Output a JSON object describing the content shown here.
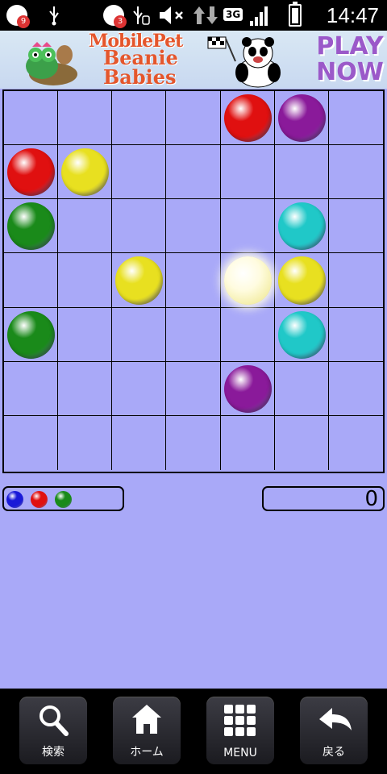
{
  "status_bar": {
    "time": "14:47",
    "network": "3G",
    "notification_badges": [
      "9",
      "3"
    ],
    "icons": [
      "notification-icon",
      "usb-icon",
      "notification-icon",
      "usb-debug-icon",
      "mute-icon",
      "data-transfer-icon",
      "network-3g-icon",
      "signal-icon",
      "battery-icon"
    ]
  },
  "ad": {
    "title_line1": "MobilePet",
    "title_line2": "Beanie",
    "title_line3": "Babies",
    "cta_line1": "PLAY",
    "cta_line2": "NOW"
  },
  "board": {
    "rows": 7,
    "cols": 7,
    "balls": [
      {
        "row": 0,
        "col": 4,
        "color": "red"
      },
      {
        "row": 0,
        "col": 5,
        "color": "purple"
      },
      {
        "row": 1,
        "col": 0,
        "color": "red"
      },
      {
        "row": 1,
        "col": 1,
        "color": "yellow"
      },
      {
        "row": 2,
        "col": 0,
        "color": "green"
      },
      {
        "row": 2,
        "col": 5,
        "color": "cyan"
      },
      {
        "row": 3,
        "col": 2,
        "color": "yellow"
      },
      {
        "row": 3,
        "col": 4,
        "color": "yellow",
        "selected": true
      },
      {
        "row": 3,
        "col": 5,
        "color": "yellow"
      },
      {
        "row": 4,
        "col": 0,
        "color": "green"
      },
      {
        "row": 4,
        "col": 5,
        "color": "cyan"
      },
      {
        "row": 5,
        "col": 4,
        "color": "purple"
      }
    ]
  },
  "next_balls": [
    "blue",
    "red",
    "green"
  ],
  "score": "0",
  "nav": [
    {
      "label": "検索",
      "icon": "search-icon"
    },
    {
      "label": "ホーム",
      "icon": "home-icon"
    },
    {
      "label": "MENU",
      "icon": "menu-grid-icon"
    },
    {
      "label": "戻る",
      "icon": "back-arrow-icon"
    }
  ],
  "colors": {
    "background": "#a9a9f8",
    "red": "#e01010",
    "purple": "#8a1a9a",
    "yellow": "#e8e020",
    "green": "#1a8a1a",
    "cyan": "#20c8c8",
    "blue": "#1a1ad8"
  }
}
